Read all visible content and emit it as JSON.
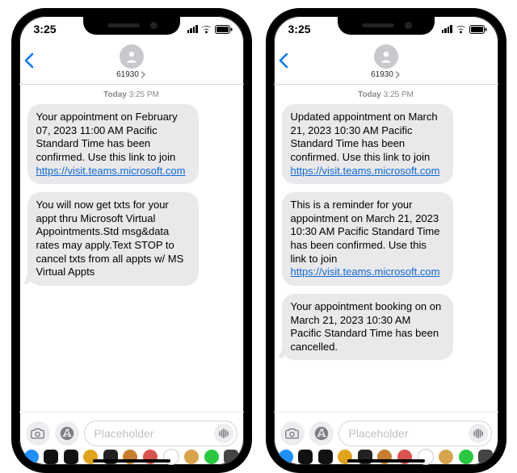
{
  "status": {
    "time": "3:25"
  },
  "header": {
    "contact_number": "61930"
  },
  "timestamp": {
    "day": "Today",
    "time": "3:25 PM"
  },
  "phoneA": {
    "m1_pre": "Your appointment on February 07, 2023 11:00 AM Pacific Standard Time has been confirmed. Use this link to join ",
    "m1_link": "https://visit.teams.microsoft.com",
    "m2": "You will now get txts for your appt thru Microsoft Virtual Appointments.Std msg&data rates may apply.Text STOP to cancel txts from all appts w/ MS Virtual Appts"
  },
  "phoneB": {
    "m1_pre": "Updated appointment on March 21, 2023 10:30 AM Pacific Standard Time has been confirmed. Use this link to join ",
    "m1_link": "https://visit.teams.microsoft.com",
    "m2_pre": "This is a reminder for your appointment on March 21, 2023 10:30 AM Pacific Standard Time has been confirmed. Use this link to join ",
    "m2_link": "https://visit.teams.microsoft.com",
    "m3": "Your appointment booking on on March 21, 2023 10:30 AM Pacific Standard Time has been cancelled."
  },
  "compose": {
    "placeholder": "Placeholder"
  },
  "dock_colors": [
    "#1e90ff",
    "#111",
    "#111",
    "#e0a31a",
    "#111",
    "#c77f2f",
    "#d9534f",
    "#fff",
    "#d8a44a",
    "#28c940",
    "#444"
  ]
}
